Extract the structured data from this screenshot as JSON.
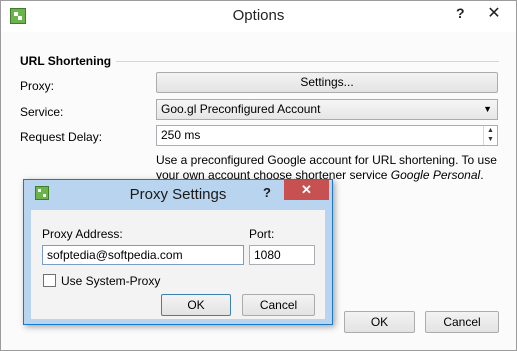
{
  "options": {
    "title": "Options",
    "help_symbol": "?",
    "close_symbol": "✕",
    "group_title": "URL Shortening",
    "proxy_label": "Proxy:",
    "proxy_button": "Settings...",
    "service_label": "Service:",
    "service_value": "Goo.gl Preconfigured Account",
    "delay_label": "Request Delay:",
    "delay_value": "250 ms",
    "description_prefix": "Use a preconfigured Google account for URL shortening. To use your own account choose shortener service ",
    "description_italic": "Google Personal",
    "description_suffix": ".",
    "ok_label": "OK",
    "cancel_label": "Cancel"
  },
  "proxy_dialog": {
    "title": "Proxy Settings",
    "help_symbol": "?",
    "close_symbol": "✕",
    "address_label": "Proxy Address:",
    "address_value": "sofptedia@softpedia.com",
    "port_label": "Port:",
    "port_value": "1080",
    "system_proxy_label": "Use System-Proxy",
    "system_proxy_checked": false,
    "ok_label": "OK",
    "cancel_label": "Cancel"
  },
  "colors": {
    "dialog_frame": "#b9d4ee",
    "close_button": "#c75050",
    "app_icon": "#6bb34a"
  },
  "icons": {
    "app": "app-grid-icon",
    "dropdown": "chevron-down-icon",
    "spinner": "spin-updown-icon"
  }
}
